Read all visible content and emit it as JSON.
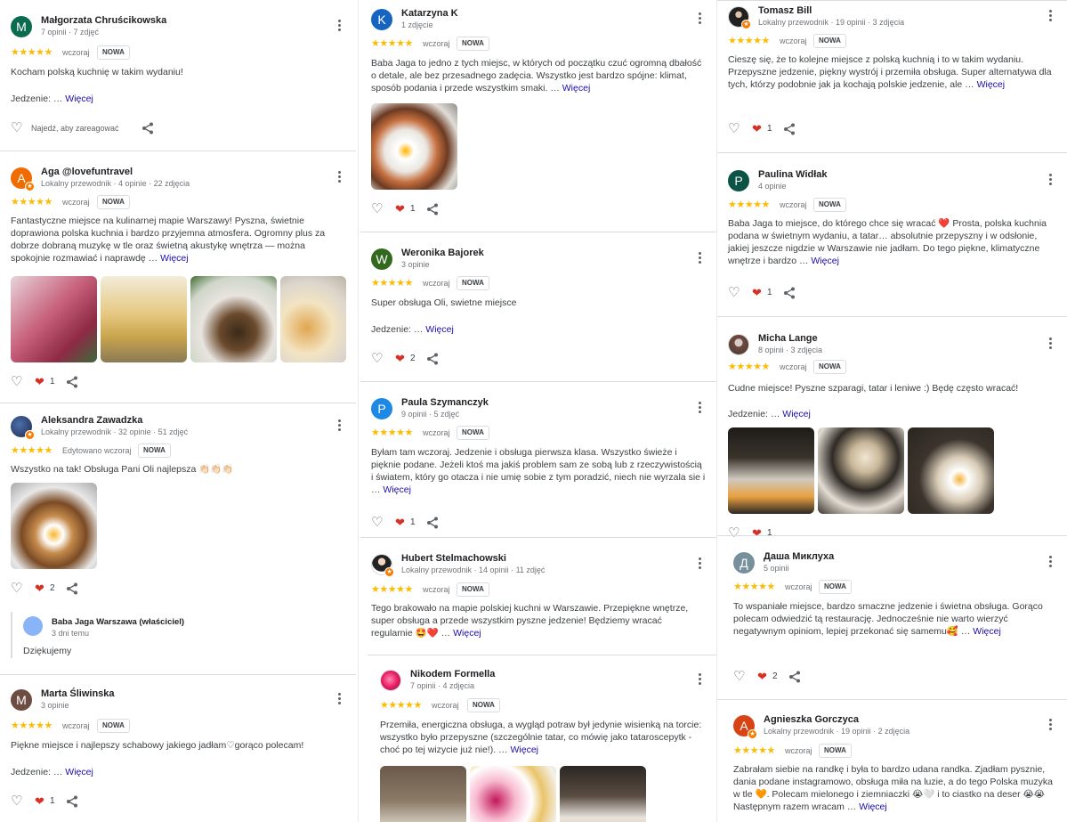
{
  "ui": {
    "more_label": "Więcej",
    "new_badge": "NOWA",
    "stars": "★★★★★",
    "react_prompt": "Najedź, aby zareagować"
  },
  "colors": {
    "star": "#fbbc04",
    "link": "#1a0dab",
    "heart": "#d93025"
  },
  "reviews": [
    {
      "name": "Małgorzata Chruścikowska",
      "meta": "7 opinii · 7 zdjęć",
      "avatar_letter": "M",
      "avatar_color": "#0b6b4f",
      "date": "wczoraj",
      "text": "Kocham polską kuchnię w takim wydaniu!",
      "extra": "Jedzenie: …",
      "likes": ""
    },
    {
      "name": "Aga @lovefuntravel",
      "meta": "Lokalny przewodnik · 4 opinie · 22 zdjęcia",
      "avatar_letter": "A",
      "avatar_color": "#ef6c00",
      "date": "wczoraj",
      "text": "Fantastyczne miejsce na kulinarnej mapie Warszawy! Pyszna, świetnie doprawiona polska kuchnia i bardzo przyjemna atmosfera. Ogromny plus za dobrze dobraną muzykę w tle oraz świetną akustykę wnętrza — można spokojnie rozmawiać i naprawdę …",
      "likes": "1"
    },
    {
      "name": "Aleksandra Zawadzka",
      "meta": "Lokalny przewodnik · 32 opinie · 51 zdjęć",
      "avatar_letter": "",
      "avatar_color": "#1f2a44",
      "date": "Edytowano wczoraj",
      "text": "Wszystko na tak! Obsługa Pani Oli najlepsza 👏🏻👏🏻👏🏻",
      "likes": "2",
      "owner": {
        "name": "Baba Jaga Warszawa (właściciel)",
        "meta": "3 dni temu",
        "text": "Dziękujemy"
      }
    },
    {
      "name": "Marta Śliwinska",
      "meta": "3 opinie",
      "avatar_letter": "M",
      "avatar_color": "#6d4c41",
      "date": "wczoraj",
      "text": "Piękne miejsce i najlepszy schabowy jakiego jadłam♡gorąco polecam!",
      "extra": "Jedzenie: …",
      "likes": "1"
    },
    {
      "name": "Katarzyna K",
      "meta": "1 zdjęcie",
      "avatar_letter": "K",
      "avatar_color": "#1565c0",
      "date": "wczoraj",
      "text": "Baba Jaga to jedno z tych miejsc, w których od początku czuć ogromną dbałość o detale, ale bez przesadnego zadęcia. Wszystko jest bardzo spójne: klimat, sposób podania i przede wszystkim smaki. …",
      "likes": "1"
    },
    {
      "name": "Weronika Bajorek",
      "meta": "3 opinie",
      "avatar_letter": "W",
      "avatar_color": "#33691e",
      "date": "wczoraj",
      "text": "Super obsługa Oli, swietne miejsce",
      "extra": "Jedzenie: …",
      "likes": "2"
    },
    {
      "name": "Paula Szymanczyk",
      "meta": "9 opinii · 5 zdjęć",
      "avatar_letter": "P",
      "avatar_color": "#1e88e5",
      "date": "wczoraj",
      "text": "Byłam tam wczoraj. Jedzenie i obsługa pierwsza klasa. Wszystko świeże i pięknie podane. Jeżeli ktoś ma jakiś problem sam ze sobą lub z rzeczywistością i światem, który go otacza i nie umię sobie z tym poradzić, niech nie wyrzala sie i …",
      "likes": "1"
    },
    {
      "name": "Hubert Stelmachowski",
      "meta": "Lokalny przewodnik · 14 opinii · 11 zdjęć",
      "avatar_letter": "",
      "avatar_color": "#3e2723",
      "date": "wczoraj",
      "text": "Tego brakowało na mapie polskiej kuchni w Warszawie. Przepiękne wnętrze, super obsługa a przede wszystkim pyszne jedzenie! Będziemy wracać regularnie 🤩❤️ …",
      "likes": ""
    },
    {
      "name": "Nikodem Formella",
      "meta": "7 opinii · 4 zdjęcia",
      "avatar_letter": "",
      "avatar_color": "#e91e63",
      "date": "wczoraj",
      "text": "Przemiła, energiczna obsługa, a wygląd potraw był jedynie wisienką na torcie: wszystko było przepyszne (szczególnie tatar, co mówię jako tataroscepytk - choć po tej wizycie już nie!). …",
      "likes": ""
    },
    {
      "name": "Tomasz Bill",
      "meta": "Lokalny przewodnik · 19 opinii · 3 zdjęcia",
      "avatar_letter": "",
      "avatar_color": "#212121",
      "date": "wczoraj",
      "text": "Cieszę się, że to kolejne miejsce z polską kuchnią i to w takim wydaniu. Przepyszne jedzenie, piękny wystrój i przemiła obsługa. Super alternatywa dla tych, którzy podobnie jak ja kochają polskie jedzenie, ale …",
      "likes": "1"
    },
    {
      "name": "Paulina Widłak",
      "meta": "4 opinie",
      "avatar_letter": "P",
      "avatar_color": "#0b5345",
      "date": "wczoraj",
      "text": "Baba Jaga to miejsce, do którego chce się wracać ❤️ Prosta, polska kuchnia podana w świetnym wydaniu, a tatar… absolutnie przepyszny i w odsłonie, jakiej jeszcze nigdzie w Warszawie nie jadłam. Do tego piękne, klimatyczne wnętrze i bardzo …",
      "likes": "1"
    },
    {
      "name": "Micha Lange",
      "meta": "8 opinii · 3 zdjęcia",
      "avatar_letter": "",
      "avatar_color": "#8d6e63",
      "date": "wczoraj",
      "text": "Cudne miejsce! Pyszne szparagi, tatar i leniwe :) Będę często wracać!",
      "extra": "Jedzenie: …",
      "likes": "1"
    },
    {
      "name": "Даша Миклуха",
      "meta": "5 opinii",
      "avatar_letter": "Д",
      "avatar_color": "#78909c",
      "date": "wczoraj",
      "text": "To wspaniałe miejsce, bardzo smaczne jedzenie i świetna obsługa. Gorąco polecam odwiedzić tą restaurację. Jednocześnie nie warto wierzyć negatywnym opiniom, lepiej przekonać się samemu🥰 …",
      "likes": "2"
    },
    {
      "name": "Agnieszka Gorczyca",
      "meta": "Lokalny przewodnik · 19 opinii · 2 zdjęcia",
      "avatar_letter": "A",
      "avatar_color": "#d84315",
      "date": "wczoraj",
      "text": "Zabrałam siebie na randkę i była to bardzo udana randka. Zjadłam pysznie, dania podane instagramowo, obsługa miła na luzie, a do tego Polska muzyka w tle 🧡. Polecam mielonego i ziemniaczki 😭🤍 i to ciastko na deser 😭😭 Następnym razem wracam …",
      "likes": ""
    }
  ]
}
